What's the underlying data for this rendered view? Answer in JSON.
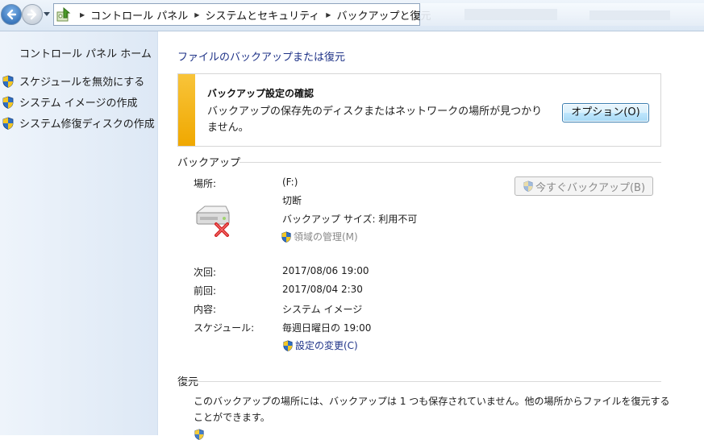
{
  "breadcrumb": {
    "items": [
      "コントロール パネル",
      "システムとセキュリティ",
      "バックアップと復元"
    ]
  },
  "sidebar": {
    "home": "コントロール パネル ホーム",
    "links": [
      "スケジュールを無効にする",
      "システム イメージの作成",
      "システム修復ディスクの作成"
    ]
  },
  "main": {
    "title": "ファイルのバックアップまたは復元",
    "notice": {
      "title": "バックアップ設定の確認",
      "text": "バックアップの保存先のディスクまたはネットワークの場所が見つかりません。",
      "button": "オプション(O)"
    },
    "backup": {
      "heading": "バックアップ",
      "location_label": "場所:",
      "location_value": "(F:)",
      "status": "切断",
      "size": "バックアップ サイズ: 利用不可",
      "manage_link": "領域の管理(M)",
      "backup_now_button": "今すぐバックアップ(B)",
      "next_label": "次回:",
      "next_value": "2017/08/06 19:00",
      "last_label": "前回:",
      "last_value": "2017/08/04 2:30",
      "contents_label": "内容:",
      "contents_value": "システム イメージ",
      "schedule_label": "スケジュール:",
      "schedule_value": "毎週日曜日の 19:00",
      "change_settings_link": "設定の変更(C)"
    },
    "restore": {
      "heading": "復元",
      "text": "このバックアップの場所には、バックアップは 1 つも保存されていません。他の場所からファイルを復元することができます。"
    }
  },
  "colors": {
    "link": "#1e3287",
    "notice_bar": "#f0a800",
    "sidebar_bg": "#e6eef8"
  }
}
